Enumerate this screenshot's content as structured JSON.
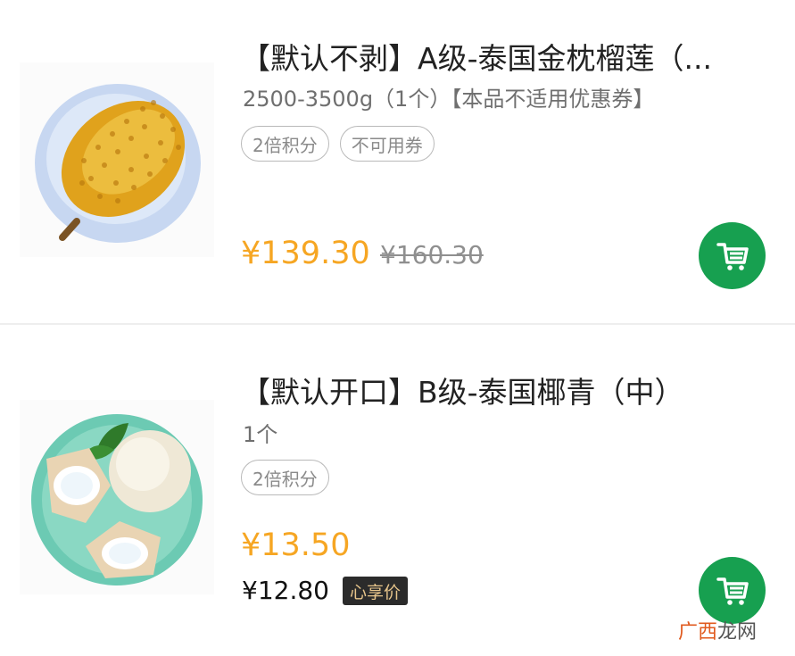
{
  "products": [
    {
      "title": "【默认不剥】A级-泰国金枕榴莲（...",
      "subtitle": "2500-3500g（1个）【本品不适用优惠券】",
      "tags": [
        "2倍积分",
        "不可用券"
      ],
      "price": "¥139.30",
      "original_price": "¥160.30",
      "image_icon": "durian-image",
      "cart_icon": "cart-icon"
    },
    {
      "title": "【默认开口】B级-泰国椰青（中）",
      "subtitle": "1个",
      "tags": [
        "2倍积分"
      ],
      "price": "¥13.50",
      "member_price": "¥12.80",
      "member_badge": "心享价",
      "image_icon": "coconut-image",
      "cart_icon": "cart-icon"
    }
  ],
  "watermark": {
    "part1": "广西",
    "part2": "龙网"
  },
  "colors": {
    "price": "#f6a623",
    "cart_button": "#17a050",
    "tag_border": "#b9b9b9"
  }
}
